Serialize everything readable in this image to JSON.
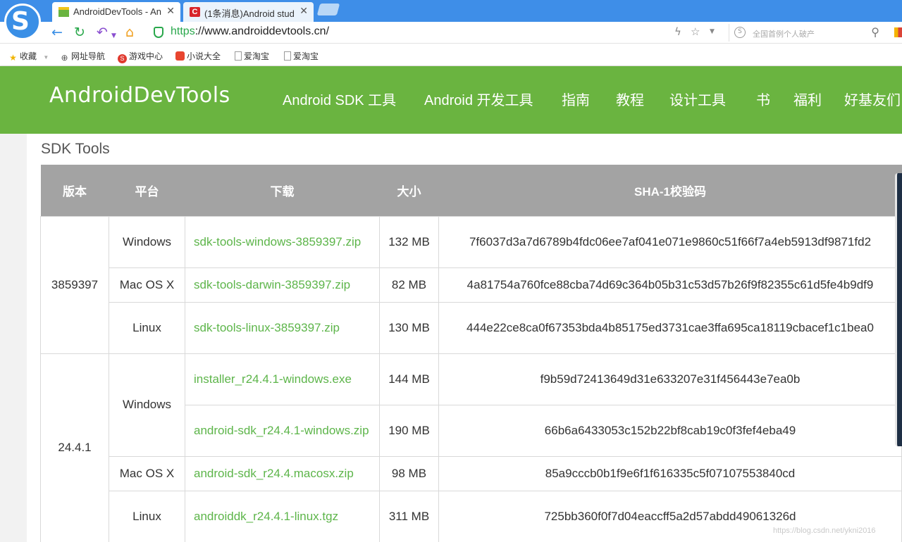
{
  "browser": {
    "tabs": [
      {
        "title": "AndroidDevTools - An",
        "active": true,
        "icon": "androiddevtools-favicon"
      },
      {
        "title": "(1条消息)Android stud",
        "active": false,
        "icon": "csdn-favicon"
      }
    ],
    "close_glyph": "✕",
    "url_scheme": "https",
    "url_rest": "://www.androiddevtools.cn/",
    "search_placeholder": "全国首例个人破产",
    "bookmarks": [
      {
        "label": "收藏",
        "icon": "star-icon"
      },
      {
        "label": "网址导航",
        "icon": "globe-icon"
      },
      {
        "label": "游戏中心",
        "icon": "game-icon"
      },
      {
        "label": "小说大全",
        "icon": "book-icon"
      },
      {
        "label": "爱淘宝",
        "icon": "page-icon"
      },
      {
        "label": "爱淘宝",
        "icon": "page-icon"
      }
    ]
  },
  "site": {
    "logo": "AndroidDevTools",
    "nav": [
      "Android SDK 工具",
      "Android 开发工具",
      "指南",
      "教程",
      "设计工具",
      "书",
      "福利",
      "好基友们"
    ]
  },
  "section_title": "SDK Tools",
  "table": {
    "headers": [
      "版本",
      "平台",
      "下载",
      "大小",
      "SHA-1校验码"
    ],
    "groups": [
      {
        "version": "3859397",
        "rows": [
          {
            "platform": "Windows",
            "file": "sdk-tools-windows-3859397.zip",
            "size": "132 MB",
            "sha1": "7f6037d3a7d6789b4fdc06ee7af041e071e9860c51f66f7a4eb5913df9871fd2"
          },
          {
            "platform": "Mac OS X",
            "file": "sdk-tools-darwin-3859397.zip",
            "size": "82 MB",
            "sha1": "4a81754a760fce88cba74d69c364b05b31c53d57b26f9f82355c61d5fe4b9df9"
          },
          {
            "platform": "Linux",
            "file": "sdk-tools-linux-3859397.zip",
            "size": "130 MB",
            "sha1": "444e22ce8ca0f67353bda4b85175ed3731cae3ffa695ca18119cbacef1c1bea0"
          }
        ]
      },
      {
        "version": "24.4.1",
        "rows": [
          {
            "platform": "Windows",
            "file": "installer_r24.4.1-windows.exe",
            "size": "144 MB",
            "sha1": "f9b59d72413649d31e633207e31f456443e7ea0b"
          },
          {
            "platform": "",
            "file": "android-sdk_r24.4.1-windows.zip",
            "size": "190 MB",
            "sha1": "66b6a6433053c152b22bf8cab19c0f3fef4eba49"
          },
          {
            "platform": "Mac OS X",
            "file": "android-sdk_r24.4.macosx.zip",
            "size": "98 MB",
            "sha1": "85a9cccb0b1f9e6f1f616335c5f07107553840cd"
          },
          {
            "platform": "Linux",
            "file": "androiddk_r24.4.1-linux.tgz",
            "size": "311 MB",
            "sha1": "725bb360f0f7d04eaccff5a2d57abdd49061326d"
          }
        ]
      }
    ]
  },
  "watermark": "https://blog.csdn.net/ykni2016",
  "colors": {
    "brand_green": "#6ab440",
    "link_green": "#5db54a",
    "header_gray": "#a3a3a3",
    "browser_blue": "#3e8ee8"
  }
}
